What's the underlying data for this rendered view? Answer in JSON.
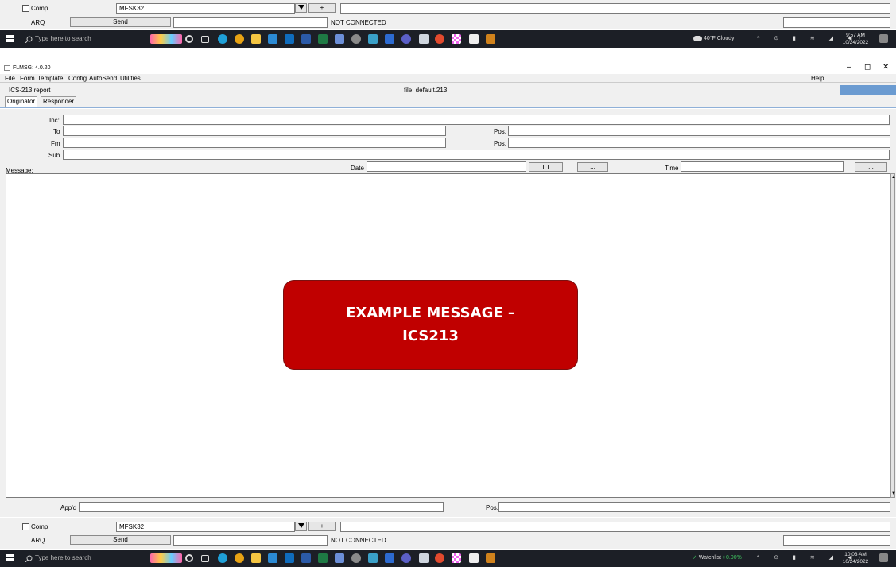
{
  "top_modem_bar": {
    "comp_label": "Comp",
    "mode_value": "MFSK32",
    "plus_label": "+",
    "arq_label": "ARQ",
    "send_label": "Send",
    "status": "NOT CONNECTED"
  },
  "taskbar_top": {
    "search_placeholder": "Type here to search",
    "weather": "40°F Cloudy",
    "time": "9:57 AM",
    "date": "10/24/2022"
  },
  "window": {
    "title": "FLMSG: 4.0.20",
    "menu": [
      "File",
      "Form",
      "Template",
      "Config",
      "AutoSend",
      "Utilities"
    ],
    "help": "Help",
    "report_name": "ICS-213 report",
    "file_label": "file: default.213",
    "tabs": [
      "Originator",
      "Responder"
    ]
  },
  "form": {
    "inc_label": "Inc:",
    "to_label": "To",
    "fm_label": "Fm",
    "sub_label": "Sub.",
    "pos_label": "Pos.",
    "message_label": "Message:",
    "date_label": "Date",
    "time_label": "Time",
    "ellipsis": "...",
    "appd_label": "App'd"
  },
  "callout": {
    "line1": "EXAMPLE MESSAGE –",
    "line2": "ICS213"
  },
  "bottom_modem_bar": {
    "comp_label": "Comp",
    "mode_value": "MFSK32",
    "plus_label": "+",
    "arq_label": "ARQ",
    "send_label": "Send",
    "status": "NOT CONNECTED"
  },
  "taskbar_bottom": {
    "search_placeholder": "Type here to search",
    "watchlist": "Watchlist",
    "watch_change": "+0.90%",
    "time": "10:03 AM",
    "date": "10/24/2022"
  },
  "colors": {
    "callout_bg": "#c00000",
    "taskbar_bg": "#1c1f26",
    "accent_blue": "#6b9bd1"
  }
}
